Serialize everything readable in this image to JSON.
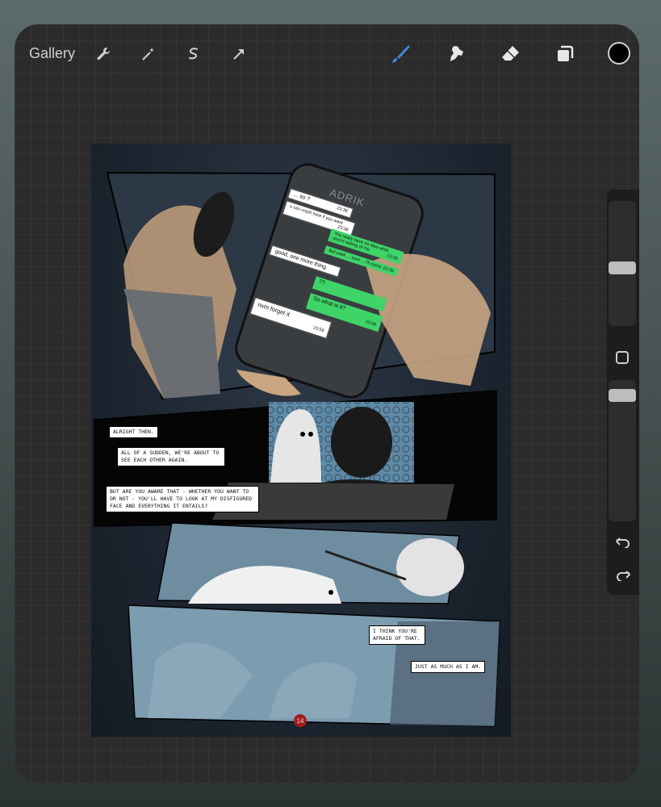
{
  "toolbar": {
    "gallery_label": "Gallery",
    "left_tools": [
      "wrench-icon",
      "magic-wand-icon",
      "selection-icon",
      "transform-arrow-icon"
    ],
    "right_tools": [
      "brush-icon",
      "smudge-icon",
      "eraser-icon",
      "layers-icon"
    ],
    "active_tool": "brush-icon",
    "color": "#000000",
    "accent": "#3a8ee6"
  },
  "comic": {
    "phone": {
      "contact": "ADRIK",
      "messages": [
        {
          "text": "... so ?",
          "time": "23:38",
          "side": "in"
        },
        {
          "text": "u can crash here if you want",
          "time": "23:38",
          "side": "in"
        },
        {
          "text": "You really have no idea what you're asking of me.",
          "time": "23:39",
          "side": "out"
        },
        {
          "text": "But yeah ... sure ... I'll come.",
          "time": "23:39",
          "side": "out"
        },
        {
          "text": "good, one more thing",
          "time": "",
          "side": "in"
        },
        {
          "text": "??",
          "time": "",
          "side": "out"
        },
        {
          "text": "So what is it?",
          "time": "23:59",
          "side": "out"
        },
        {
          "text": "nvm forget it",
          "time": "23:59",
          "side": "in"
        }
      ]
    },
    "captions": [
      "ALRIGHT THEN.",
      "ALL OF A SUDDEN, WE'RE ABOUT TO SEE EACH OTHER AGAIN.",
      "BUT ARE YOU AWARE THAT - WHETHER YOU WANT TO OR NOT - YOU'LL HAVE TO LOOK AT MY DISFIGURED FACE AND EVERYTHING IT ENTAILS?",
      "I THINK YOU'RE AFRAID OF THAT.",
      "JUST AS MUCH AS I AM."
    ],
    "page_number": "14"
  },
  "sidebar": {
    "brush_size": 0.46,
    "opacity": 0.93,
    "undo_icon": "undo-icon",
    "redo_icon": "redo-icon"
  }
}
